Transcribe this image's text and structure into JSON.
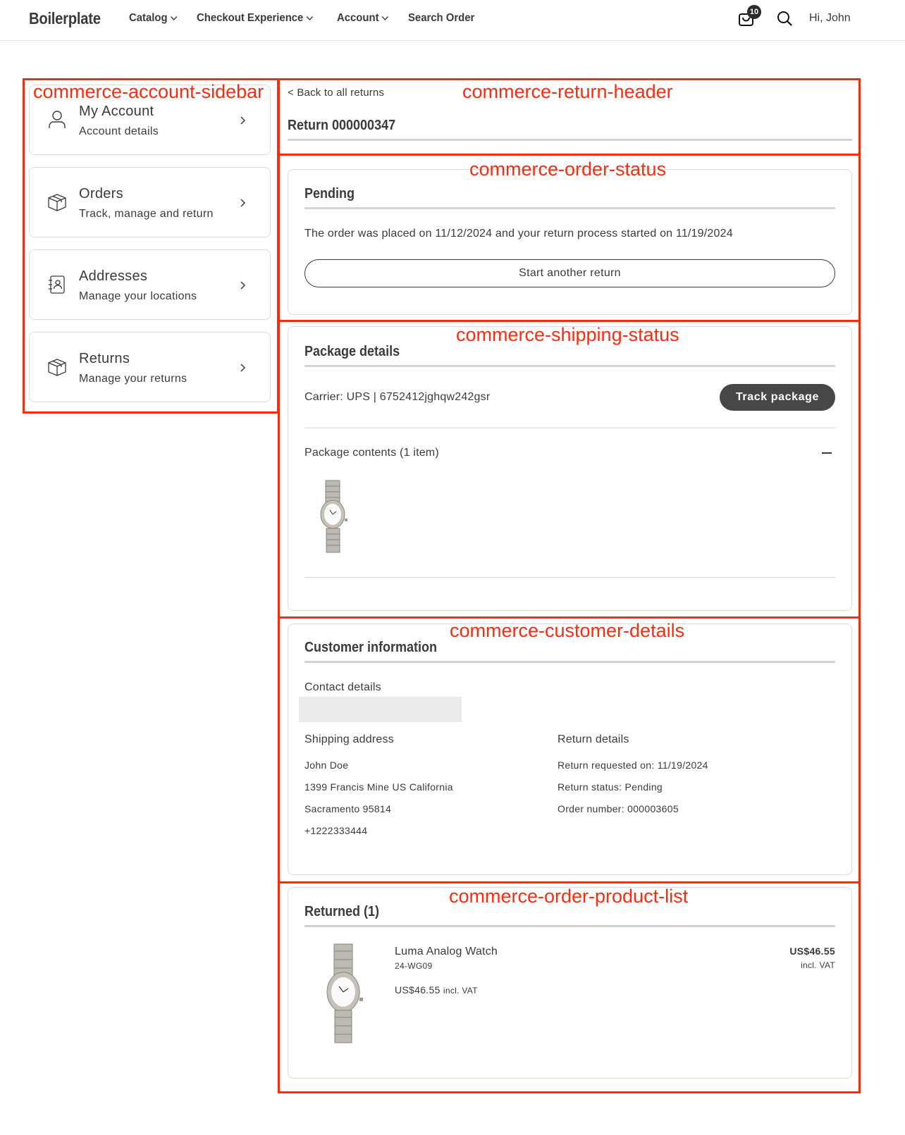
{
  "header": {
    "brand": "Boilerplate",
    "nav": [
      {
        "label": "Catalog",
        "has_dropdown": true
      },
      {
        "label": "Checkout Experience",
        "has_dropdown": true
      },
      {
        "label": "Account",
        "has_dropdown": true
      },
      {
        "label": "Search Order",
        "has_dropdown": false
      }
    ],
    "cart_icon": "shopping-bag-icon",
    "cart_count": "10",
    "search_icon": "search-icon",
    "greeting": "Hi, John"
  },
  "annotations": {
    "sidebar": "commerce-account-sidebar",
    "return_header": "commerce-return-header",
    "order_status": "commerce-order-status",
    "shipping_status": "commerce-shipping-status",
    "customer_details": "commerce-customer-details",
    "product_list": "commerce-order-product-list",
    "color": "#ff2a0e"
  },
  "sidebar": {
    "items": [
      {
        "title": "My Account",
        "subtitle": "Account details",
        "icon": "user-icon"
      },
      {
        "title": "Orders",
        "subtitle": "Track, manage and return",
        "icon": "box-icon"
      },
      {
        "title": "Addresses",
        "subtitle": "Manage your locations",
        "icon": "address-book-icon"
      },
      {
        "title": "Returns",
        "subtitle": "Manage your returns",
        "icon": "box-icon"
      }
    ]
  },
  "return_header": {
    "back_link": "< Back to all returns",
    "title": "Return 000000347"
  },
  "order_status": {
    "heading": "Pending",
    "message": "The order was placed on 11/12/2024 and your return process started on 11/19/2024",
    "button": "Start another return"
  },
  "shipping_status": {
    "heading": "Package details",
    "carrier_line": "Carrier: UPS | 6752412jghqw242gsr",
    "track_button": "Track package",
    "contents_label": "Package contents (1 item)",
    "collapse_icon": "minus-icon"
  },
  "customer_details": {
    "heading": "Customer information",
    "contact_label": "Contact details",
    "shipping_label": "Shipping address",
    "shipping_lines": [
      "John  Doe",
      "1399 Francis Mine  US  California",
      "Sacramento  95814",
      "+1222333444"
    ],
    "return_label": "Return details",
    "return_lines": [
      "Return requested on: 11/19/2024",
      "Return status: Pending",
      "Order number: 000003605"
    ]
  },
  "product_list": {
    "heading": "Returned (1)",
    "items": [
      {
        "name": "Luma Analog Watch",
        "sku": "24-WG09",
        "price": "US$46.55",
        "price_suffix": "incl. VAT",
        "total": "US$46.55",
        "total_suffix": "incl. VAT"
      }
    ]
  }
}
